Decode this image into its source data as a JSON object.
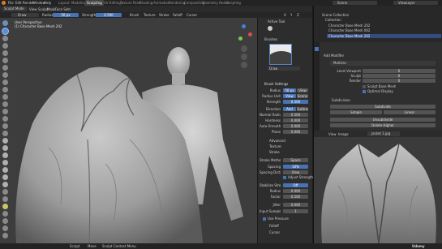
{
  "menubar": {
    "items": [
      "File",
      "Edit",
      "Render",
      "Window",
      "Help"
    ],
    "workspace_tabs": [
      "Layout",
      "Modeling",
      "Sculpting",
      "UV Editing",
      "Texture Paint",
      "Shading",
      "Animation",
      "Rendering",
      "Compositing",
      "Geometry Nodes",
      "Scripting"
    ],
    "active_tab": "Sculpting",
    "scene": "Scene",
    "view_layer": "ViewLayer"
  },
  "header": {
    "mode": "Sculpt Mode",
    "menus": [
      "View",
      "Sculpt",
      "Mask",
      "Face Sets"
    ],
    "brush": "Draw",
    "radius_label": "Radius",
    "radius_value": "50 px",
    "strength_label": "Strength",
    "strength_value": "0.500",
    "brush_menu": "Brush",
    "texture_menu": "Texture",
    "stroke_menu": "Stroke",
    "falloff_menu": "Falloff",
    "cursor_menu": "Cursor",
    "x_label": "X",
    "y_label": "Y",
    "z_label": "Z"
  },
  "viewport": {
    "view_name": "User Perspective",
    "object_name": "(1) Character Base Mesh 202"
  },
  "tool_properties": {
    "symmetry_label": "Symmetry",
    "sym_menu": "Sculpt",
    "options": "Options",
    "brushes_title": "Brushes",
    "brush_name": "Draw",
    "textures_label": "Textures",
    "active_tool": "Active Tool",
    "brush_settings_title": "Brush Settings",
    "rows": [
      {
        "label": "Radius",
        "value": "50 px",
        "unit": "View"
      },
      {
        "label": "Radius Unit",
        "value": "View",
        "unit": "Scene"
      },
      {
        "label": "Strength",
        "value": "0.500",
        "unit": ""
      },
      {
        "label": "Direction",
        "value": "Add",
        "unit": "Subtract"
      },
      {
        "label": "Normal Radius",
        "value": "0.500",
        "unit": ""
      },
      {
        "label": "Hardness",
        "value": "0.000",
        "unit": ""
      },
      {
        "label": "Auto-Smooth",
        "value": "0.000",
        "unit": ""
      },
      {
        "label": "Plane",
        "value": "0.000",
        "unit": ""
      }
    ],
    "sections": [
      "Advanced",
      "Texture",
      "Stroke"
    ],
    "stroke_rows": [
      {
        "label": "Stroke Method",
        "value": "Space"
      },
      {
        "label": "Spacing",
        "value": "10%"
      },
      {
        "label": "Spacing Distance",
        "value": "View"
      },
      {
        "label": "",
        "value": "Adjust Strength"
      },
      {
        "label": "Stabilize Stroke",
        "value": "Off"
      },
      {
        "label": "Radius",
        "value": "0.000"
      },
      {
        "label": "Factor",
        "value": "0.500"
      },
      {
        "label": "Jitter",
        "value": "0.000"
      },
      {
        "label": "Input Samples",
        "value": "1"
      }
    ],
    "bottom_sections": [
      "Falloff",
      "Cursor"
    ],
    "checkbox_labels": [
      "Use Pressure",
      "Stabilize Stroke",
      "Dyntopo"
    ]
  },
  "outliner": {
    "title": "Scene Collection",
    "items": [
      "Collection",
      "Character Base Mesh 202",
      "Character Base Mesh 002",
      "Character Base Mesh 202"
    ]
  },
  "properties": {
    "modifier_label": "Add Modifier",
    "modifier_name": "Multires",
    "rows": [
      {
        "label": "Level Viewport",
        "value": "0"
      },
      {
        "label": "Sculpt",
        "value": "0"
      },
      {
        "label": "Render",
        "value": "0"
      }
    ],
    "checks": [
      "Sculpt Base Mesh",
      "Optimal Display"
    ],
    "subdivision": "Subdivision",
    "buttons": [
      "Subdivide",
      "Simple",
      "Linear"
    ],
    "unsubdivide": "Unsubdivide",
    "delete_higher": "Delete Higher"
  },
  "image_editor": {
    "menus": [
      "View",
      "Image"
    ],
    "image_name": "jacket 1.jpg"
  },
  "statusbar": {
    "left": "Sculpt",
    "mid": "Move",
    "right": "Sculpt Context Menu",
    "version": "3.6.1"
  },
  "watermark": "Udemy"
}
